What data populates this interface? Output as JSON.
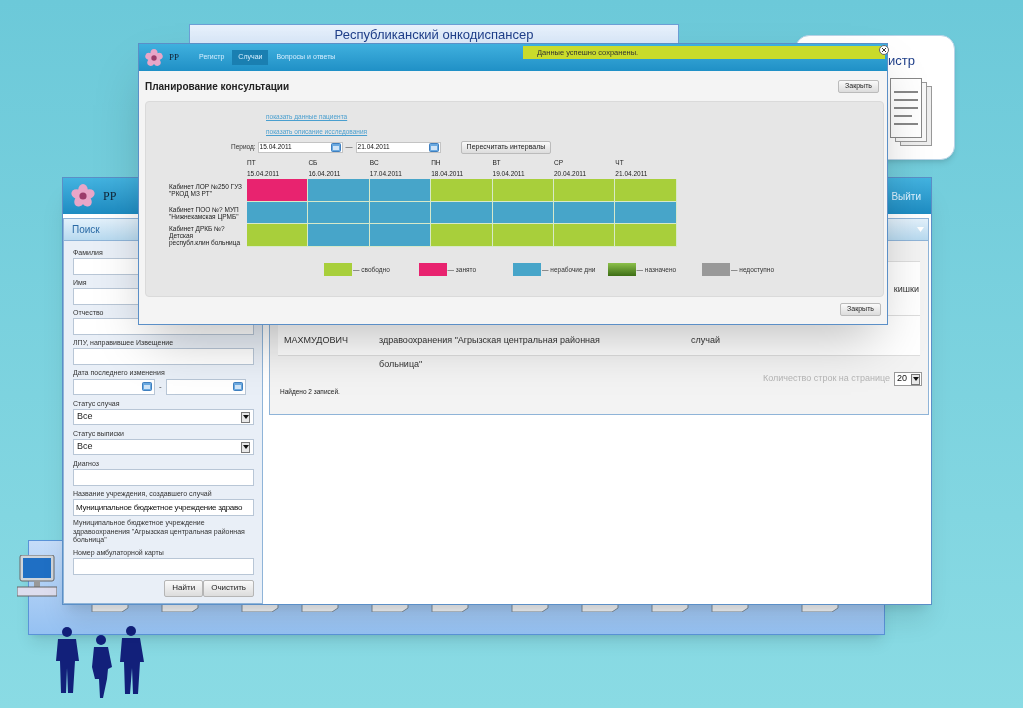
{
  "slide": {
    "title": "Республиканский онкодиспансер",
    "card_text": "истр"
  },
  "main_window": {
    "logo": "PP",
    "logout": "Выйти",
    "search_panel": {
      "title": "Поиск",
      "fields": [
        {
          "kind": "text",
          "label": "Фамилия"
        },
        {
          "kind": "text",
          "label": "Имя"
        },
        {
          "kind": "text",
          "label": "Отчество"
        },
        {
          "kind": "text",
          "label": "ЛПУ, направившее Извещение"
        },
        {
          "kind": "date_range",
          "label": "Дата последнего изменения",
          "separator": "-"
        },
        {
          "kind": "select",
          "label": "Статус случая",
          "value": "Все"
        },
        {
          "kind": "select",
          "label": "Статус выписки",
          "value": "Все"
        },
        {
          "kind": "text",
          "label": "Диагноз"
        },
        {
          "kind": "text",
          "label": "Название учреждения, создавшего случай",
          "value": "Муниципальное бюджетное учреждение здраво",
          "note": "Муниципальное бюджетное учреждение здравоохранения \"Агрызская центральная районная больница\""
        },
        {
          "kind": "text",
          "label": "Номер амбулаторной карты"
        }
      ],
      "buttons": [
        "Найти",
        "Очистить"
      ]
    },
    "results": {
      "rows": [
        {
          "column_5": "кишки"
        },
        {
          "column_1": "МАХМУДОВИЧ",
          "column_2": "здравоохранения \"Агрызская центральная районная больница\"",
          "column_4": "случай"
        }
      ],
      "page_size_label": "Количество строк на странице",
      "page_size": "20",
      "found": "Найдено 2 записей."
    }
  },
  "dialog": {
    "logo": "PP",
    "nav": [
      {
        "label": "Регистр",
        "selected": false
      },
      {
        "label": "Случаи",
        "selected": true
      },
      {
        "label": "Вопросы и ответы",
        "selected": false
      }
    ],
    "notification": "Данные успешно сохранены.",
    "title": "Планирование консультации",
    "close_button": "Закрыть",
    "links": [
      "показать данные пациента",
      "показать описание исследования"
    ],
    "period": {
      "label": "Период:",
      "from": "15.04.2011",
      "separator": "—",
      "to": "21.04.2011",
      "button": "Пересчитать интервалы"
    },
    "days": [
      {
        "weekday": "ПТ",
        "date": "15.04.2011"
      },
      {
        "weekday": "СБ",
        "date": "16.04.2011"
      },
      {
        "weekday": "ВС",
        "date": "17.04.2011"
      },
      {
        "weekday": "ПН",
        "date": "18.04.2011"
      },
      {
        "weekday": "ВТ",
        "date": "19.04.2011"
      },
      {
        "weekday": "СР",
        "date": "20.04.2011"
      },
      {
        "weekday": "ЧТ",
        "date": "21.04.2011"
      }
    ],
    "rooms": [
      {
        "name": "Кабинет ЛОР №250 ГУЗ\n\"РКОД МЗ РТ\"",
        "cells": [
          {
            "kind": "busy"
          },
          {
            "kind": "nonworking"
          },
          {
            "kind": "nonworking"
          },
          {
            "kind": "free"
          },
          {
            "kind": "free"
          },
          {
            "kind": "free"
          },
          {
            "kind": "free"
          }
        ]
      },
      {
        "name": "Кабинет ПОО №? МУП\n\"Нижнекамская ЦРМБ\"",
        "cells": [
          {
            "kind": "nonworking"
          },
          {
            "kind": "nonworking"
          },
          {
            "kind": "nonworking"
          },
          {
            "kind": "nonworking"
          },
          {
            "kind": "nonworking"
          },
          {
            "kind": "nonworking"
          },
          {
            "kind": "nonworking"
          }
        ]
      },
      {
        "name": "Кабинет ДРКБ №?\nДетская\nреспубл.клин больница",
        "cells": [
          {
            "kind": "free"
          },
          {
            "kind": "nonworking"
          },
          {
            "kind": "nonworking"
          },
          {
            "kind": "free"
          },
          {
            "kind": "free"
          },
          {
            "kind": "free"
          },
          {
            "kind": "free"
          }
        ]
      }
    ],
    "legend": [
      {
        "kind": "free",
        "label": "— свободно"
      },
      {
        "kind": "busy",
        "label": "— занято"
      },
      {
        "kind": "nonworking",
        "label": "— нерабочие дни"
      },
      {
        "kind": "assigned",
        "label": "— назначено"
      },
      {
        "kind": "unavailable",
        "label": "— недоступно"
      }
    ],
    "footer_button": "Закрыть"
  }
}
